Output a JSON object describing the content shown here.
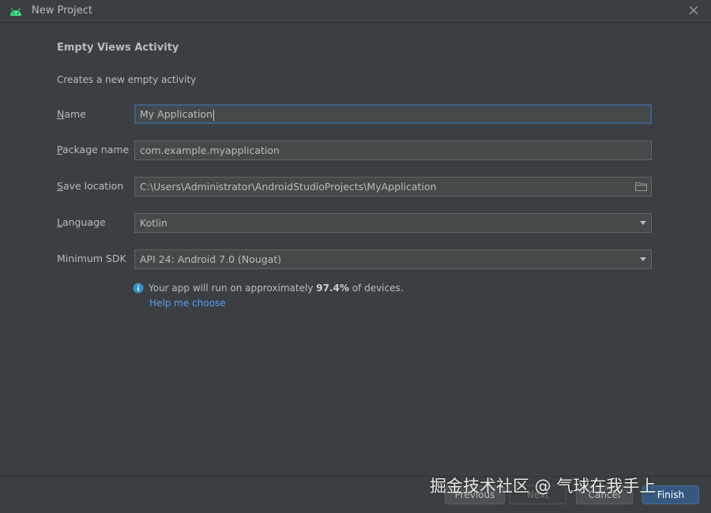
{
  "window": {
    "title": "New Project",
    "icon": "android-icon",
    "close_icon": "close-icon"
  },
  "section": {
    "title": "Empty Views Activity",
    "description": "Creates a new empty activity"
  },
  "fields": {
    "name": {
      "label_mnemonic": "N",
      "label_rest": "ame",
      "value": "My Application"
    },
    "package": {
      "label_mnemonic": "P",
      "label_rest": "ackage name",
      "value": "com.example.myapplication"
    },
    "save_location": {
      "label_mnemonic": "S",
      "label_rest": "ave location",
      "value": "C:\\Users\\Administrator\\AndroidStudioProjects\\MyApplication",
      "icon": "folder-icon"
    },
    "language": {
      "label_mnemonic": "L",
      "label_rest": "anguage",
      "value": "Kotlin"
    },
    "min_sdk": {
      "label": "Minimum SDK",
      "value": "API 24: Android 7.0 (Nougat)"
    }
  },
  "info": {
    "icon": "info-icon",
    "text_before": "Your app will run on approximately ",
    "percent": "97.4%",
    "text_after": " of devices.",
    "help_link": "Help me choose"
  },
  "buttons": {
    "previous": "Previous",
    "next": "Next",
    "cancel": "Cancel",
    "finish": "Finish"
  },
  "watermark": "掘金技术社区 @ 气球在我手上",
  "colors": {
    "background": "#3c3f41",
    "field_background": "#45494a",
    "focus_border": "#3d6185",
    "link": "#589df6",
    "info_icon": "#3592c4",
    "android_green": "#3ddc84",
    "primary_button": "#365880"
  }
}
